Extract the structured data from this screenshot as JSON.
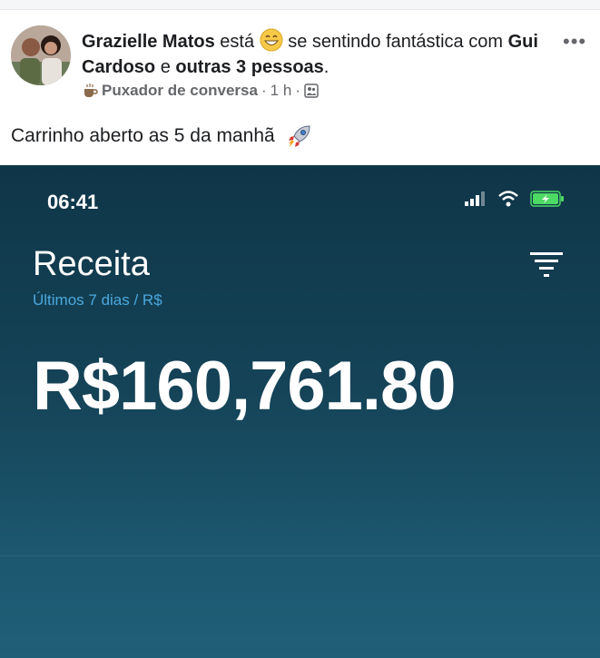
{
  "post": {
    "author": "Grazielle Matos",
    "verb": "está",
    "feeling": "se sentindo fantástica",
    "with_word": "com",
    "tagged": "Gui Cardoso",
    "and_word": "e",
    "others": "outras 3 pessoas",
    "period": ".",
    "badge": "Puxador de conversa",
    "time": "1 h",
    "text": "Carrinho aberto as 5 da manhã",
    "emoji_feeling": "grinning-face-icon",
    "emoji_rocket": "rocket-icon"
  },
  "screenshot": {
    "status_time": "06:41",
    "title": "Receita",
    "subtitle": "Últimos 7 dias / R$",
    "amount": "R$160,761.80",
    "accent_color": "#4aa8de",
    "battery_color": "#4cd964"
  }
}
